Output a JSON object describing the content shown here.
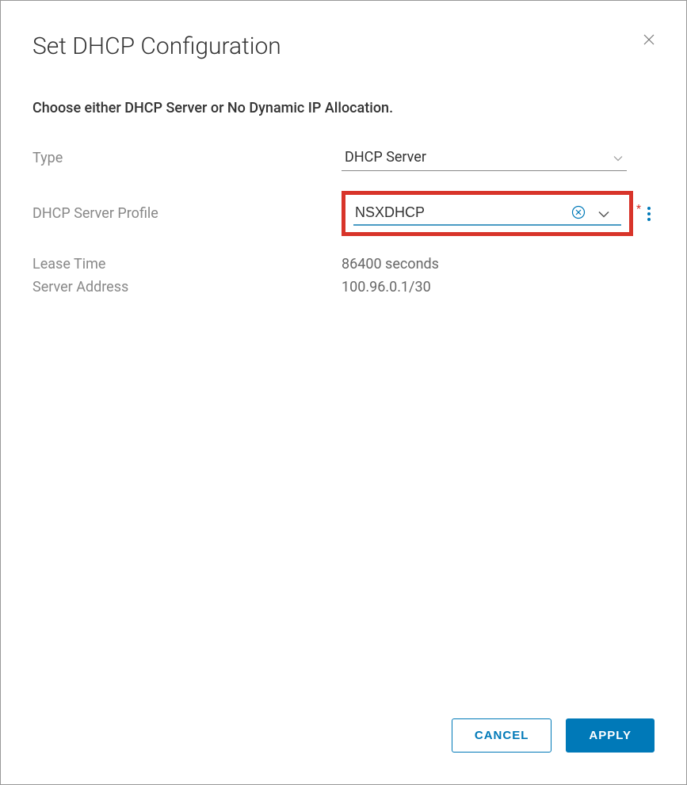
{
  "dialog": {
    "title": "Set DHCP Configuration",
    "instruction": "Choose either DHCP Server or No Dynamic IP Allocation."
  },
  "fields": {
    "type_label": "Type",
    "type_value": "DHCP Server",
    "profile_label": "DHCP Server Profile",
    "profile_value": "NSXDHCP",
    "lease_label": "Lease Time",
    "lease_value": "86400 seconds",
    "address_label": "Server Address",
    "address_value": "100.96.0.1/30"
  },
  "buttons": {
    "cancel": "CANCEL",
    "apply": "APPLY"
  }
}
